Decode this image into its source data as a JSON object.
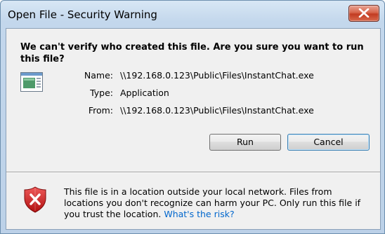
{
  "window": {
    "title": "Open File - Security Warning"
  },
  "dialog": {
    "question": "We can't verify who created this file. Are you sure you want to run this file?",
    "fields": [
      {
        "label": "Name:",
        "value": "\\\\192.168.0.123\\Public\\Files\\InstantChat.exe"
      },
      {
        "label": "Type:",
        "value": "Application"
      },
      {
        "label": "From:",
        "value": "\\\\192.168.0.123\\Public\\Files\\InstantChat.exe"
      }
    ],
    "buttons": {
      "run": "Run",
      "cancel": "Cancel"
    },
    "warning": {
      "text": "This file is in a location outside your local network. Files from locations you don't recognize can harm your PC. Only run this file if you trust the location.",
      "link": "What's the risk?"
    }
  },
  "icons": {
    "file": "application-file-icon",
    "shield": "security-shield-error-icon",
    "close": "close-icon"
  },
  "colors": {
    "link": "#0066cc",
    "close_button": "#c23b21",
    "shield": "#cc1b1b"
  }
}
